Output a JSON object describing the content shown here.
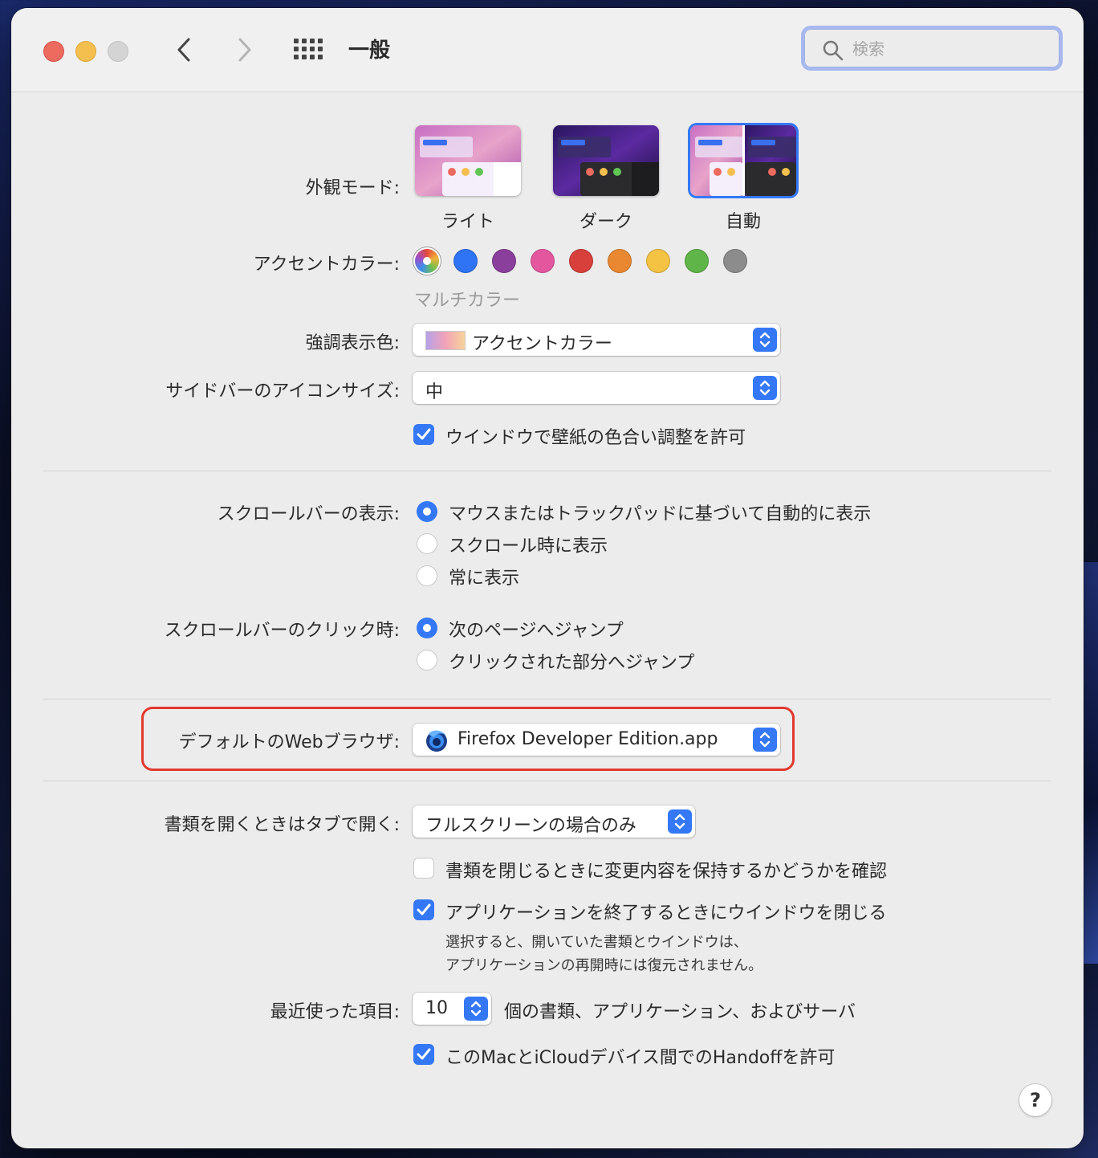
{
  "window": {
    "title": "一般",
    "search_placeholder": "検索"
  },
  "appearance": {
    "label": "外観モード:",
    "options": [
      "ライト",
      "ダーク",
      "自動"
    ],
    "selected": "自動"
  },
  "accent": {
    "label": "アクセントカラー:",
    "selected_name": "マルチカラー",
    "colors": [
      "multicolor",
      "#2f74f4",
      "#8a3f9c",
      "#e4579f",
      "#d8403c",
      "#ea8831",
      "#f5c343",
      "#5fb548",
      "#8c8c8c"
    ]
  },
  "highlight": {
    "label": "強調表示色:",
    "value": "アクセントカラー"
  },
  "sidebar_icon": {
    "label": "サイドバーのアイコンサイズ:",
    "value": "中"
  },
  "wallpaper_tint": {
    "label": "ウインドウで壁紙の色合い調整を許可",
    "checked": true
  },
  "scrollbar_show": {
    "label": "スクロールバーの表示:",
    "options": [
      "マウスまたはトラックパッドに基づいて自動的に表示",
      "スクロール時に表示",
      "常に表示"
    ],
    "selected_index": 0
  },
  "scrollbar_click": {
    "label": "スクロールバーのクリック時:",
    "options": [
      "次のページへジャンプ",
      "クリックされた部分へジャンプ"
    ],
    "selected_index": 0
  },
  "default_browser": {
    "label": "デフォルトのWebブラウザ:",
    "value": "Firefox Developer Edition.app"
  },
  "tabs": {
    "label": "書類を開くときはタブで開く:",
    "value": "フルスクリーンの場合のみ"
  },
  "ask_keep_changes": {
    "label": "書類を閉じるときに変更内容を保持するかどうかを確認",
    "checked": false
  },
  "close_windows": {
    "label": "アプリケーションを終了するときにウインドウを閉じる",
    "checked": true,
    "note_line1": "選択すると、開いていた書類とウインドウは、",
    "note_line2": "アプリケーションの再開時には復元されません。"
  },
  "recent_items": {
    "label": "最近使った項目:",
    "value": "10",
    "suffix": "個の書類、アプリケーション、およびサーバ"
  },
  "handoff": {
    "label": "このMacとiCloudデバイス間でのHandoffを許可",
    "checked": true
  },
  "help": {
    "label": "?"
  }
}
